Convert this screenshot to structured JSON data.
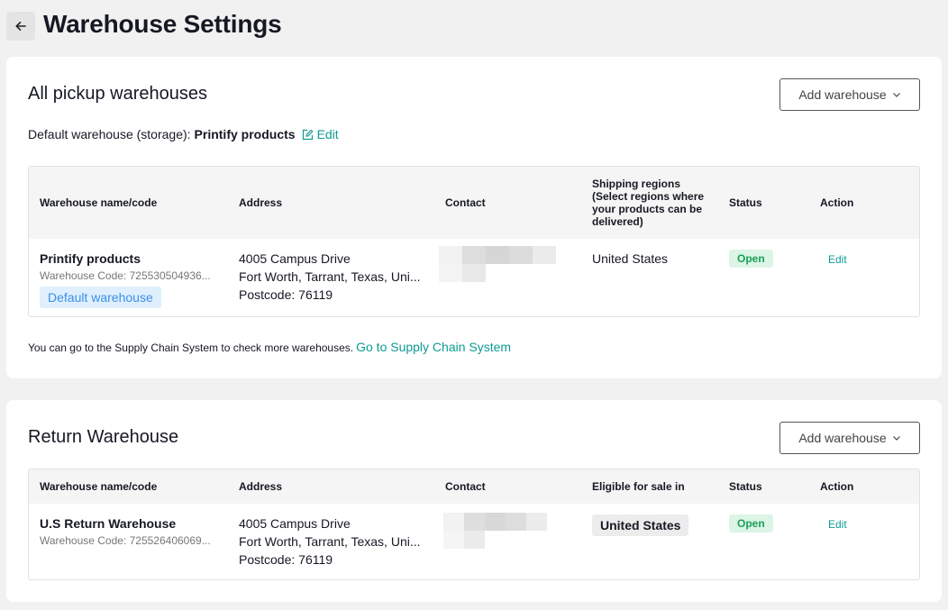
{
  "header": {
    "back_icon": "arrow-left-icon",
    "title": "Warehouse Settings"
  },
  "pickup": {
    "title": "All pickup warehouses",
    "add_button_label": "Add warehouse",
    "default_label": "Default warehouse (storage):",
    "default_value": "Printify products",
    "edit_label": "Edit",
    "columns": {
      "name": "Warehouse name/code",
      "address": "Address",
      "contact": "Contact",
      "regions": "Shipping regions (Select regions where your products can be delivered)",
      "status": "Status",
      "action": "Action"
    },
    "rows": [
      {
        "name": "Printify products",
        "code": "Warehouse Code: 725530504936...",
        "badge": "Default warehouse",
        "address_line1": "4005 Campus Drive",
        "address_line2": "Fort Worth, Tarrant, Texas, Uni...",
        "address_line3": "Postcode: 76119",
        "region": "United States",
        "status": "Open",
        "action": "Edit"
      }
    ],
    "footer_text": "You can go to the Supply Chain System to check more warehouses.",
    "footer_link": "Go to Supply Chain System"
  },
  "return_wh": {
    "title": "Return Warehouse",
    "add_button_label": "Add warehouse",
    "columns": {
      "name": "Warehouse name/code",
      "address": "Address",
      "contact": "Contact",
      "eligible": "Eligible for sale in",
      "status": "Status",
      "action": "Action"
    },
    "rows": [
      {
        "name": "U.S Return Warehouse",
        "code": "Warehouse Code: 725526406069...",
        "address_line1": "4005 Campus Drive",
        "address_line2": "Fort Worth, Tarrant, Texas, Uni...",
        "address_line3": "Postcode: 76119",
        "region": "United States",
        "status": "Open",
        "action": "Edit"
      }
    ]
  },
  "colors": {
    "accent": "#0c9b93",
    "open_green": "#18a058",
    "default_blue": "#3b8fe6"
  }
}
